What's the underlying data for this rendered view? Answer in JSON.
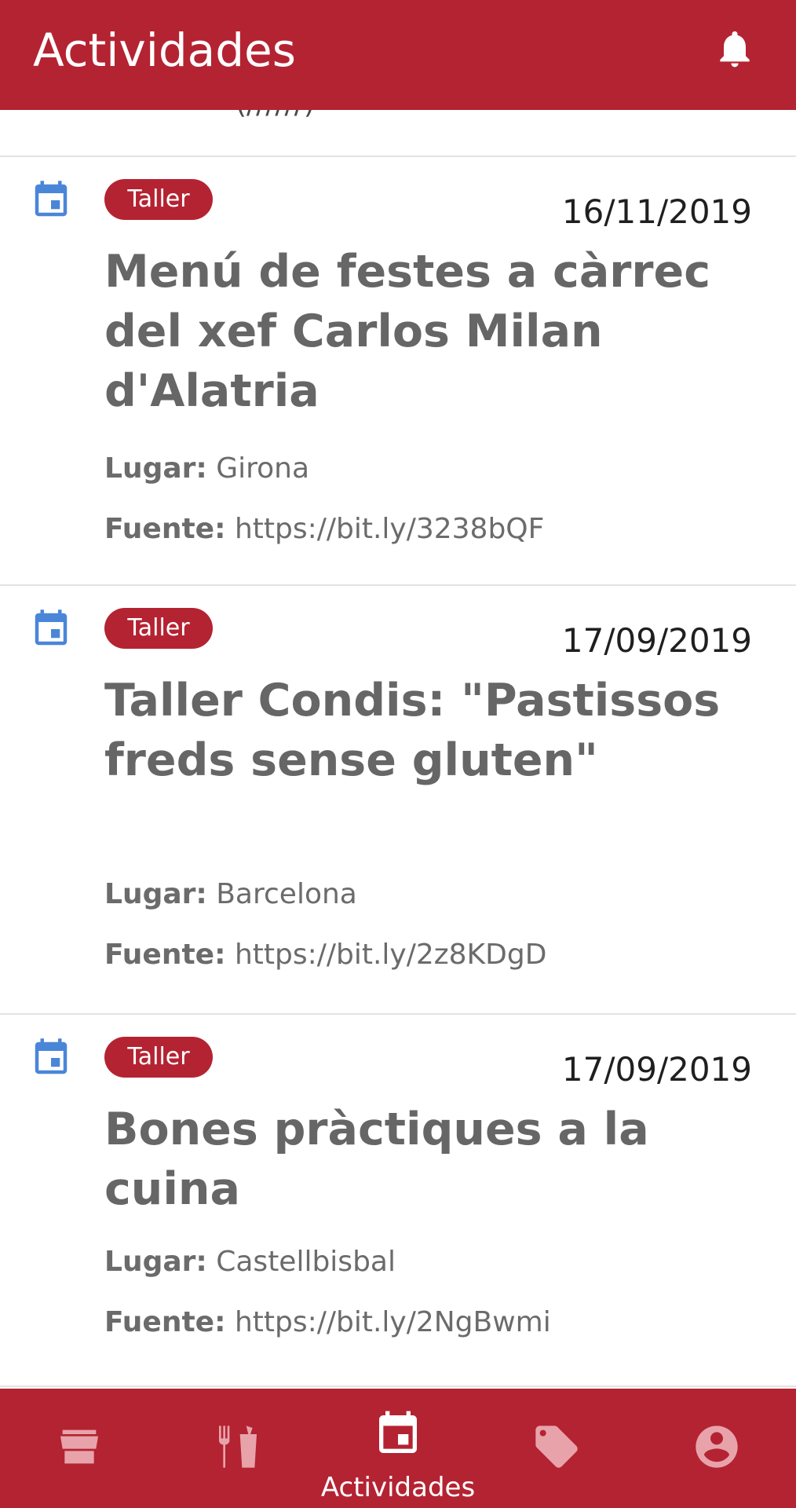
{
  "header": {
    "title": "Actividades",
    "icon": "bell-icon"
  },
  "activities": [
    {
      "tag": "Taller",
      "date": "16/11/2019",
      "title": "Menú de festes a càrrec del xef Carlos Milan d'Alatria",
      "place_label": "Lugar:",
      "place": "Girona",
      "source_label": "Fuente:",
      "source": "https://bit.ly/3238bQF"
    },
    {
      "tag": "Taller",
      "date": "17/09/2019",
      "title": "Taller Condis: \"Pastissos freds sense gluten\"",
      "place_label": "Lugar:",
      "place": "Barcelona",
      "source_label": "Fuente:",
      "source": "https://bit.ly/2z8KDgD"
    },
    {
      "tag": "Taller",
      "date": "17/09/2019",
      "title": "Bones pràctiques a la cuina",
      "place_label": "Lugar:",
      "place": "Castellbisbal",
      "source_label": "Fuente:",
      "source": "https://bit.ly/2NgBwmi"
    }
  ],
  "bottom_nav": {
    "items": [
      {
        "name": "store-icon"
      },
      {
        "name": "restaurant-icon"
      },
      {
        "name": "calendar-icon",
        "label": "Actividades",
        "active": true
      },
      {
        "name": "tag-icon"
      },
      {
        "name": "account-icon"
      }
    ]
  },
  "colors": {
    "brand": "#b42332",
    "calendar_icon": "#4a86d8",
    "inactive_icon": "#e8a3aa"
  }
}
